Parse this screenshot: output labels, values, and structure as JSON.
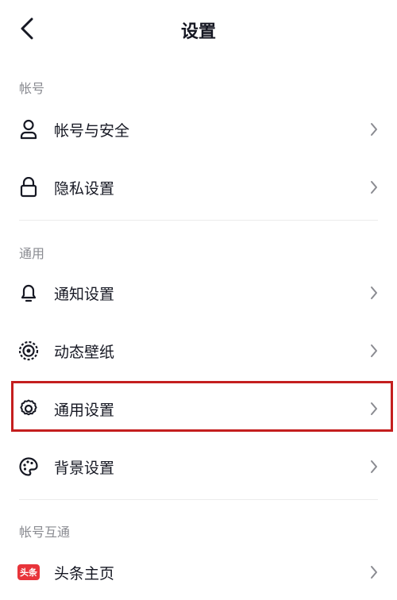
{
  "header": {
    "title": "设置",
    "back_icon": "chevron-left-icon"
  },
  "sections": {
    "account": {
      "title": "帐号"
    },
    "general": {
      "title": "通用"
    },
    "linked": {
      "title": "帐号互通"
    }
  },
  "items": {
    "account_security": {
      "label": "帐号与安全",
      "icon": "user-icon"
    },
    "privacy": {
      "label": "隐私设置",
      "icon": "lock-icon"
    },
    "notification": {
      "label": "通知设置",
      "icon": "bell-icon"
    },
    "wallpaper": {
      "label": "动态壁纸",
      "icon": "wallpaper-icon"
    },
    "general": {
      "label": "通用设置",
      "icon": "gear-icon",
      "highlighted": true
    },
    "background": {
      "label": "背景设置",
      "icon": "palette-icon"
    },
    "toutiao": {
      "label": "头条主页",
      "icon": "toutiao-badge",
      "badge_text": "头条"
    }
  },
  "colors": {
    "highlight_border": "#c41e1e",
    "badge_bg": "#e8343a",
    "section_text": "#8a8b91",
    "chevron": "#8a8b91"
  }
}
